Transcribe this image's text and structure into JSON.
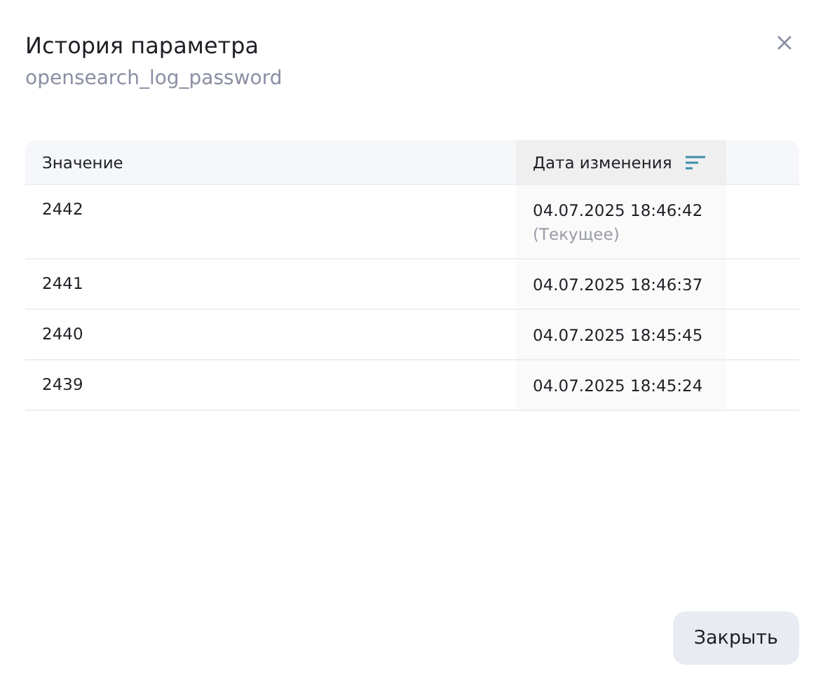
{
  "dialog": {
    "title": "История параметра",
    "subtitle": "opensearch_log_password"
  },
  "table": {
    "columns": [
      {
        "label": "Значение",
        "sorted": false
      },
      {
        "label": "Дата изменения",
        "sorted": true
      }
    ],
    "rows": [
      {
        "value": "2442",
        "date": "04.07.2025 18:46:42",
        "note": "(Текущее)"
      },
      {
        "value": "2441",
        "date": "04.07.2025 18:46:37"
      },
      {
        "value": "2440",
        "date": "04.07.2025 18:45:45"
      },
      {
        "value": "2439",
        "date": "04.07.2025 18:45:24"
      }
    ]
  },
  "buttons": [
    {
      "label": "Закрыть"
    }
  ]
}
